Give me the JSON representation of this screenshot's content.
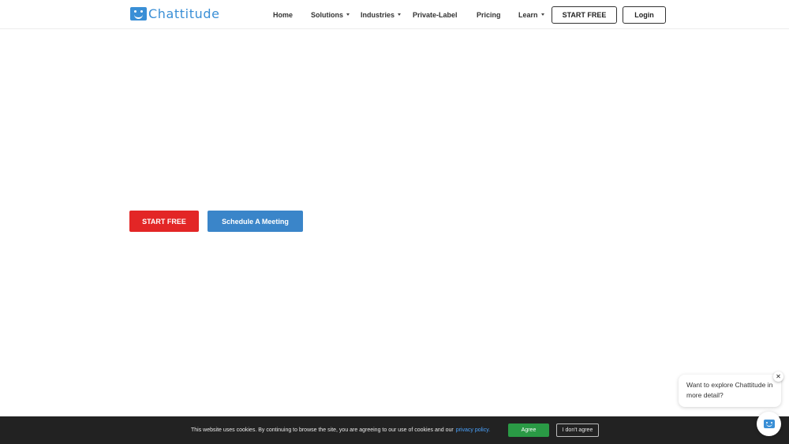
{
  "brand": {
    "name": "Chattitude",
    "color": "#3a8fd6"
  },
  "nav": {
    "home": "Home",
    "solutions": "Solutions",
    "industries": "Industries",
    "private_label": "Private-Label",
    "pricing": "Pricing",
    "learn": "Learn",
    "start_free": "START FREE",
    "login": "Login"
  },
  "hero": {
    "start_free": "START FREE",
    "schedule": "Schedule A Meeting",
    "primary_color": "#e32626",
    "secondary_color": "#3a85c9"
  },
  "chat": {
    "message": "Want to explore Chattitude in more detail?",
    "close_glyph": "✕"
  },
  "cookie": {
    "text": "This website uses cookies. By continuing to browse the site, you are agreeing to our use of cookies and our",
    "link": "privacy policy.",
    "agree": "Agree",
    "disagree": "I don't agree",
    "agree_color": "#2a9a45"
  }
}
